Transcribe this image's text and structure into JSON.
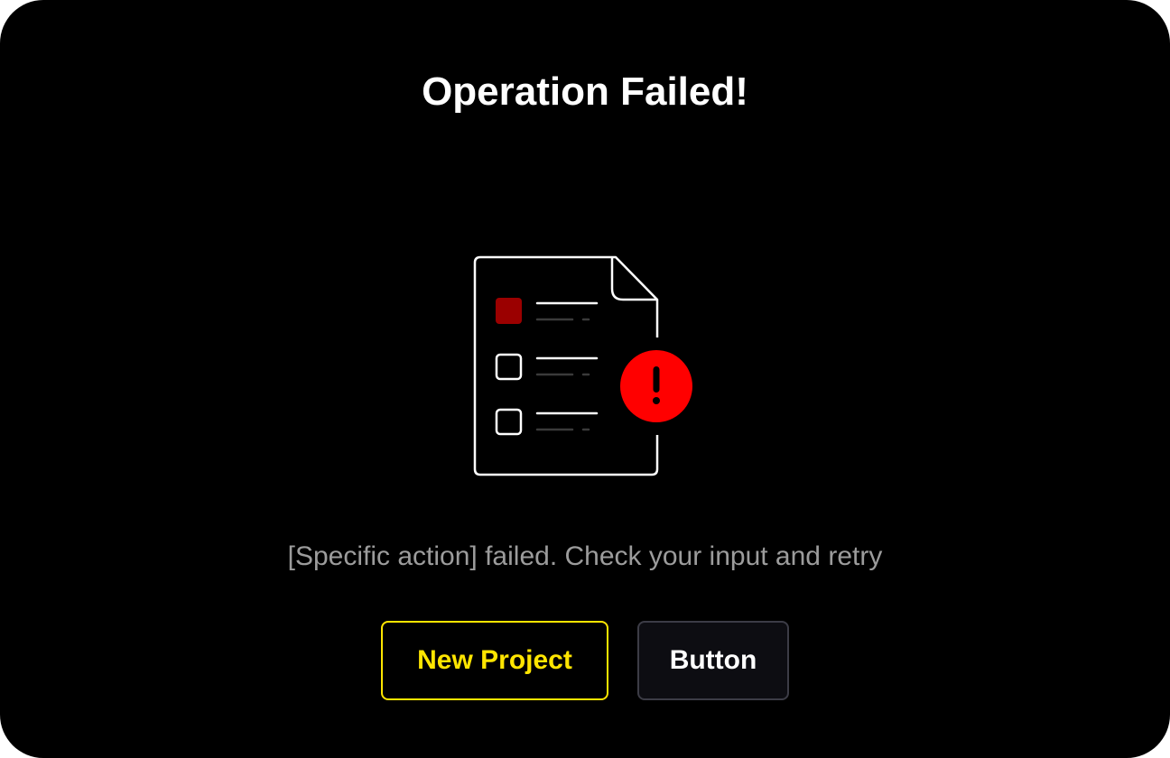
{
  "dialog": {
    "title": "Operation Failed!",
    "message": "[Specific action] failed. Check your input and retry",
    "illustration": {
      "document_icon": "document-checklist-icon",
      "alert_icon": "exclamation-circle-icon",
      "alert_color": "#ff0000",
      "checked_box_color": "#9b0000",
      "checklist_items": 3,
      "checked_items": 1
    },
    "buttons": {
      "primary_label": "New Project",
      "secondary_label": "Button"
    },
    "colors": {
      "background": "#000000",
      "title": "#ffffff",
      "message": "#9c9c9c",
      "primary_accent": "#ffe500",
      "secondary_border": "#3c3c46"
    }
  }
}
